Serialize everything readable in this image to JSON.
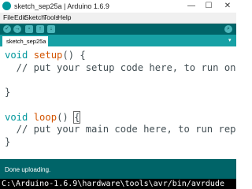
{
  "window": {
    "title": "sketch_sep25a | Arduino 1.6.9",
    "min_glyph": "—",
    "max_glyph": "☐",
    "close_glyph": "✕"
  },
  "menu": [
    "File",
    "Edit",
    "Sketch",
    "Tools",
    "Help"
  ],
  "toolbar": {
    "verify_glyph": "✓",
    "upload_glyph": "→",
    "new_glyph": "▫",
    "open_glyph": "↑",
    "save_glyph": "↓",
    "serial_glyph": "⌕"
  },
  "tab": {
    "label": "sketch_sep25a §",
    "menu_glyph": "▾"
  },
  "code": {
    "line1_kw": "void",
    "line1_fn": "setup",
    "line1_rest": "() {",
    "line2": "  // put your setup code here, to run once:",
    "line3": "",
    "line4": "}",
    "line5": "",
    "line6_kw": "void",
    "line6_fn": "loop",
    "line6_rest": "() ",
    "line6_brace": "{",
    "line7": "  // put your main code here, to run repeatedly:",
    "line8": "}"
  },
  "status": {
    "text": "Done uploading."
  },
  "console": {
    "text": "C:\\Arduino-1.6.9\\hardware\\tools\\avr/bin/avrdude"
  },
  "colors": {
    "toolbar": "#006468",
    "tabbar": "#17a1a5",
    "keyword": "#00979c",
    "function": "#d35400"
  }
}
